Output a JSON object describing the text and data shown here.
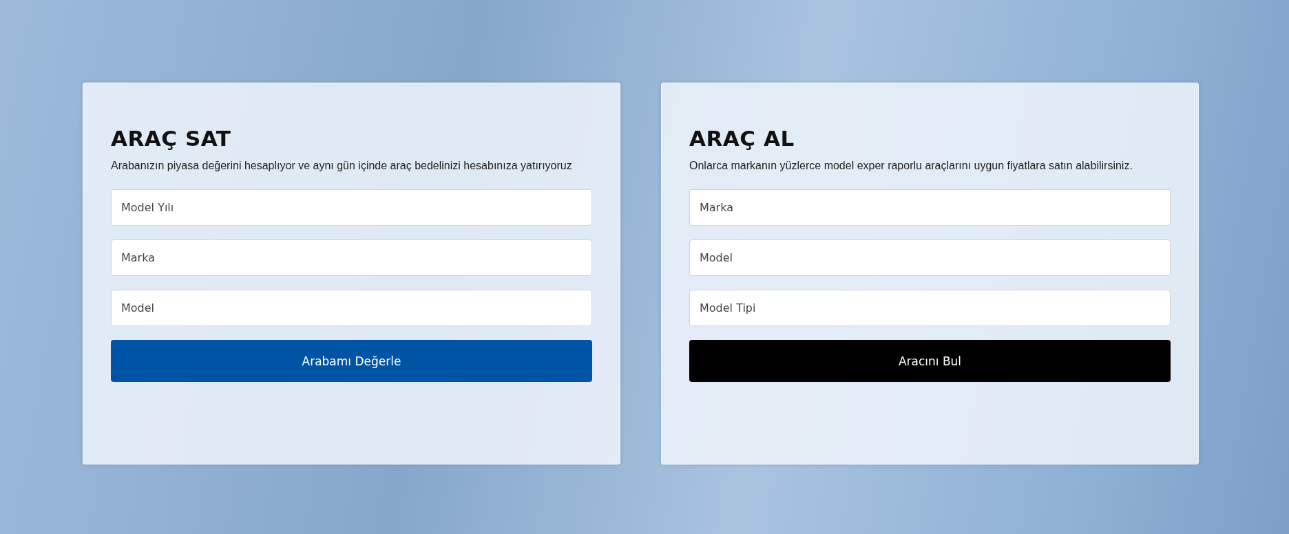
{
  "cards": [
    {
      "title": "ARAÇ SAT",
      "description": "Arabanızın piyasa değerini hesaplıyor ve aynı gün içinde araç bedelinizi hesabınıza yatırıyoruz",
      "fields": [
        {
          "placeholder": "Model Yılı"
        },
        {
          "placeholder": "Marka"
        },
        {
          "placeholder": "Model"
        }
      ],
      "button": {
        "label": "Arabamı Değerle",
        "color": "#0054a6"
      }
    },
    {
      "title": "ARAÇ AL",
      "description": "Onlarca markanın yüzlerce model exper raporlu araçlarını uygun fiyatlara satın alabilirsiniz.",
      "fields": [
        {
          "placeholder": "Marka"
        },
        {
          "placeholder": "Model"
        },
        {
          "placeholder": "Model Tipi"
        }
      ],
      "button": {
        "label": "Aracını Bul",
        "color": "#000000"
      }
    }
  ]
}
